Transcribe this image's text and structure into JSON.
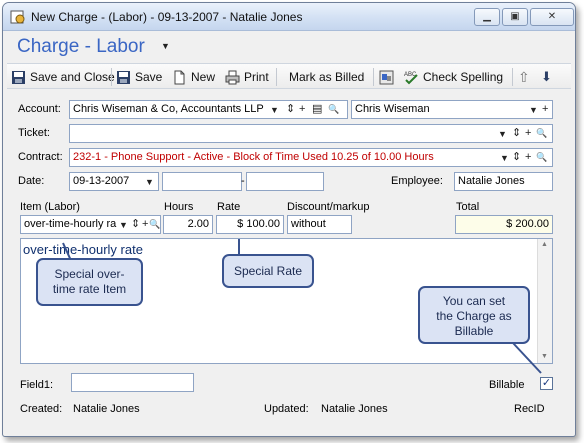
{
  "window": {
    "title": "New Charge - (Labor) - 09-13-2007 - Natalie Jones",
    "minimize_glyph": "▁",
    "maximize_glyph": "▣",
    "close_glyph": "✕"
  },
  "header": {
    "title": "Charge - Labor",
    "caret": "▼"
  },
  "toolbar": {
    "save_close": "Save and Close",
    "save": "Save",
    "new": "New",
    "print": "Print",
    "mark_billed": "Mark as Billed",
    "check_spelling": "Check Spelling",
    "up_glyph": "⇧",
    "down_glyph": "⬇"
  },
  "form": {
    "account_label": "Account:",
    "account_value": "Chris Wiseman & Co, Accountants LLP",
    "contact_value": "Chris Wiseman",
    "ticket_label": "Ticket:",
    "ticket_value": "",
    "contract_label": "Contract:",
    "contract_value": "232-1 - Phone Support - Active -  Block of Time Used 10.25 of 10.00 Hours",
    "date_label": "Date:",
    "date_value": "09-13-2007",
    "date_dash": "-",
    "employee_label": "Employee:",
    "employee_value": "Natalie Jones",
    "item_label": "Item  (Labor)",
    "hours_label": "Hours",
    "rate_label": "Rate",
    "discount_label": "Discount/markup",
    "total_label": "Total",
    "item_value": "over-time-hourly ra",
    "hours_value": "2.00",
    "rate_value": "$ 100.00",
    "discount_value": "without",
    "total_value": "$ 200.00",
    "memo_text": "over-time-hourly rate",
    "field1_label": "Field1:",
    "field1_value": "",
    "billable_label": "Billable",
    "billable_check": "✓",
    "created_label": "Created:",
    "created_value": "Natalie Jones",
    "updated_label": "Updated:",
    "updated_value": "Natalie Jones",
    "recid_label": "RecID"
  },
  "controls": {
    "dropdown": "▼",
    "spin": "⇕",
    "plus": "+",
    "search": "🔍",
    "card": "▤"
  },
  "callouts": {
    "item": "Special over-\ntime rate Item",
    "rate": "Special Rate",
    "billable": "You can set\nthe Charge as\nBillable"
  },
  "colors": {
    "title_blue": "#3a66c4",
    "contract_red": "#c00000",
    "callout_fill": "#dbe3f4",
    "callout_border": "#39538f",
    "total_fill": "#fdfde9"
  }
}
